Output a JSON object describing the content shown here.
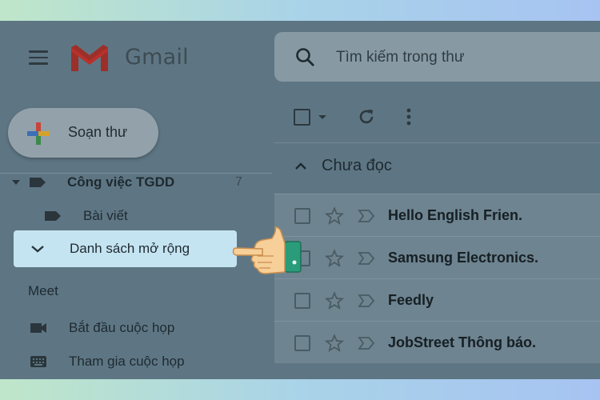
{
  "app": {
    "name": "Gmail"
  },
  "sidebar": {
    "compose_label": "Soạn thư",
    "label_group": {
      "label": "Công việc TGDD",
      "count": "7"
    },
    "sub_label": "Bài viết",
    "expand_item": "Danh sách mở rộng",
    "meet": {
      "header": "Meet",
      "items": [
        {
          "label": "Bắt đầu cuộc họp",
          "icon": "video-camera-icon"
        },
        {
          "label": "Tham gia cuộc họp",
          "icon": "keyboard-icon"
        }
      ]
    }
  },
  "search": {
    "placeholder": "Tìm kiếm trong thư"
  },
  "mail": {
    "section_title": "Chưa đọc",
    "rows": [
      {
        "sender": "Hello English Frien."
      },
      {
        "sender": "Samsung Electronics."
      },
      {
        "sender": "Feedly"
      },
      {
        "sender": "JobStreet Thông báo."
      }
    ]
  },
  "colors": {
    "overlay": "#5e7684",
    "highlight": "#c5e4f2",
    "gmail_red": "#c5221f"
  }
}
